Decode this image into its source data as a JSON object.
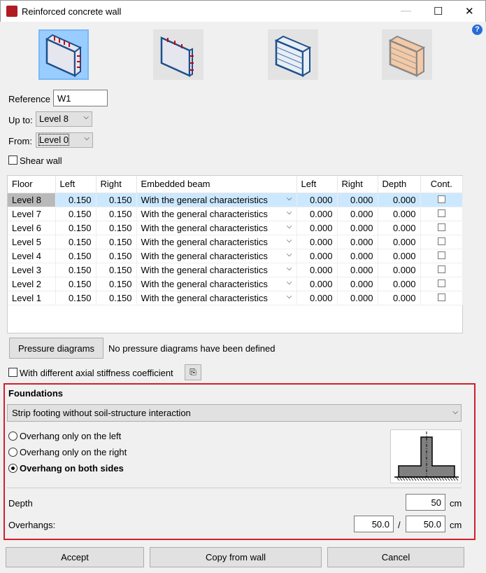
{
  "window": {
    "title": "Reinforced concrete wall",
    "help": "?"
  },
  "wall_types": [
    {
      "name": "wall-with-full-reinforcement",
      "selected": true
    },
    {
      "name": "wall-reinforcement-variant",
      "selected": false
    },
    {
      "name": "block-wall",
      "selected": false
    },
    {
      "name": "brick-wall",
      "selected": false
    }
  ],
  "form": {
    "reference_label": "Reference",
    "reference_value": "W1",
    "up_to_label": "Up to:",
    "up_to_value": "Level 8",
    "from_label": "From:",
    "from_value": "Level 0",
    "shear_wall_label": "Shear wall"
  },
  "table": {
    "headers": [
      "Floor",
      "Left",
      "Right",
      "Embedded beam",
      "Left",
      "Right",
      "Depth",
      "Cont."
    ],
    "rows": [
      [
        "Level 8",
        "0.150",
        "0.150",
        "With the general characteristics",
        "0.000",
        "0.000",
        "0.000"
      ],
      [
        "Level 7",
        "0.150",
        "0.150",
        "With the general characteristics",
        "0.000",
        "0.000",
        "0.000"
      ],
      [
        "Level 6",
        "0.150",
        "0.150",
        "With the general characteristics",
        "0.000",
        "0.000",
        "0.000"
      ],
      [
        "Level 5",
        "0.150",
        "0.150",
        "With the general characteristics",
        "0.000",
        "0.000",
        "0.000"
      ],
      [
        "Level 4",
        "0.150",
        "0.150",
        "With the general characteristics",
        "0.000",
        "0.000",
        "0.000"
      ],
      [
        "Level 3",
        "0.150",
        "0.150",
        "With the general characteristics",
        "0.000",
        "0.000",
        "0.000"
      ],
      [
        "Level 2",
        "0.150",
        "0.150",
        "With the general characteristics",
        "0.000",
        "0.000",
        "0.000"
      ],
      [
        "Level 1",
        "0.150",
        "0.150",
        "With the general characteristics",
        "0.000",
        "0.000",
        "0.000"
      ]
    ]
  },
  "pressure": {
    "button": "Pressure diagrams",
    "status": "No pressure diagrams have been defined"
  },
  "axial_label": "With different axial stiffness coefficient",
  "foundations": {
    "title": "Foundations",
    "type": "Strip footing without soil-structure interaction",
    "options": [
      "Overhang only on the left",
      "Overhang only on the right",
      "Overhang on both sides"
    ],
    "selected": 2,
    "depth_label": "Depth",
    "depth_value": "50",
    "unit": "cm",
    "overhangs_label": "Overhangs:",
    "overhang_left": "50.0",
    "overhang_right": "50.0",
    "sep": "/"
  },
  "buttons": {
    "accept": "Accept",
    "copy": "Copy from wall",
    "cancel": "Cancel"
  }
}
